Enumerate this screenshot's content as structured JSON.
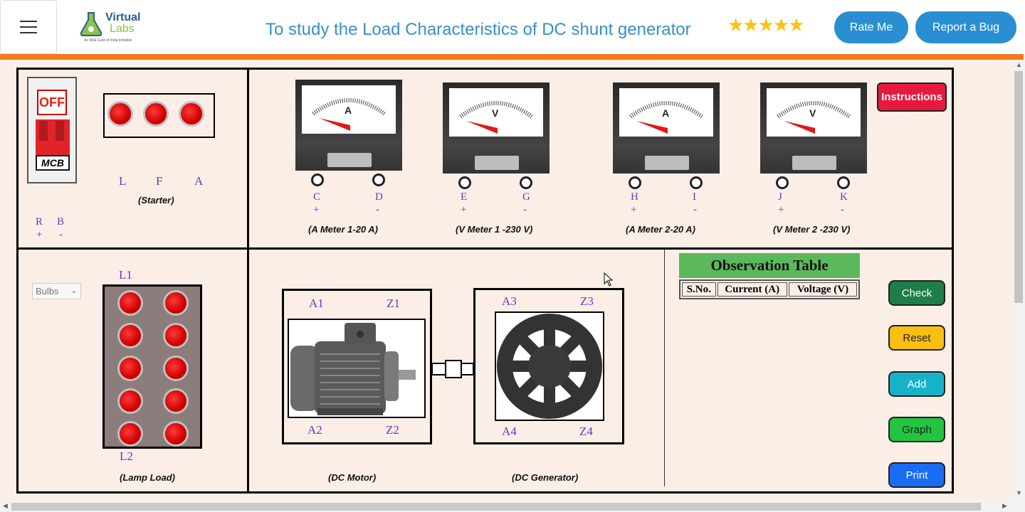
{
  "header": {
    "logo_line1": "Virtual",
    "logo_line2": "Labs",
    "logo_sub": "An MoE Govt of India Initiative",
    "title": "To study the Load Characteristics of DC shunt generator",
    "stars": "★★★★★",
    "rate_label": "Rate Me",
    "bug_label": "Report a Bug"
  },
  "mcb": {
    "state": "OFF",
    "label": "MCB"
  },
  "starter": {
    "terminals": [
      "L",
      "F",
      "A"
    ],
    "caption": "(Starter)",
    "supply_terminals": [
      {
        "name": "R",
        "sign": "+"
      },
      {
        "name": "B",
        "sign": "-"
      }
    ]
  },
  "meters": [
    {
      "letter": "A",
      "t1": "C",
      "s1": "+",
      "t2": "D",
      "s2": "-",
      "caption": "(A Meter 1-20 A)"
    },
    {
      "letter": "V",
      "t1": "E",
      "s1": "+",
      "t2": "G",
      "s2": "-",
      "caption": "(V Meter 1 -230 V)"
    },
    {
      "letter": "A",
      "t1": "H",
      "s1": "+",
      "t2": "I",
      "s2": "-",
      "caption": "(A Meter 2-20 A)"
    },
    {
      "letter": "V",
      "t1": "J",
      "s1": "+",
      "t2": "K",
      "s2": "-",
      "caption": "(V Meter 2 -230 V)"
    }
  ],
  "lamp_load": {
    "select_value": "Bulbs",
    "top_label": "L1",
    "bottom_label": "L2",
    "caption": "(Lamp Load)"
  },
  "motor": {
    "t_tl": "A1",
    "t_tr": "Z1",
    "t_bl": "A2",
    "t_br": "Z2",
    "caption": "(DC Motor)"
  },
  "generator": {
    "t_tl": "A3",
    "t_tr": "Z3",
    "t_bl": "A4",
    "t_br": "Z4",
    "caption": "(DC Generator)"
  },
  "observation": {
    "title": "Observation Table",
    "headers": [
      "S.No.",
      "Current (A)",
      "Voltage (V)"
    ]
  },
  "buttons": {
    "instructions": "Instructions",
    "check": "Check",
    "reset": "Reset",
    "add": "Add",
    "graph": "Graph",
    "print": "Print"
  },
  "colors": {
    "accent_blue": "#2a8fd2",
    "orange_bar": "#f07a1a",
    "workspace_bg": "#faeee6",
    "check": "#1e7e4a",
    "reset": "#f9be12",
    "add": "#17b2c9",
    "graph": "#22c440",
    "print": "#1a6cf5",
    "instructions": "#e8193f"
  }
}
